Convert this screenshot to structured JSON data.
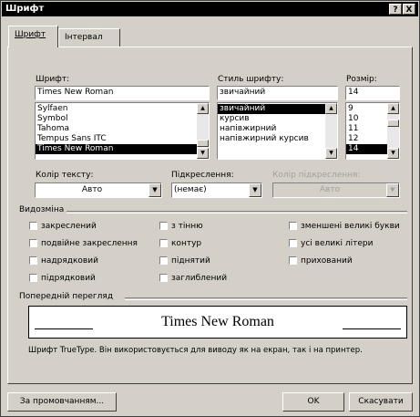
{
  "window": {
    "title": "Шрифт",
    "help_label": "?",
    "close_label": "X"
  },
  "tabs": [
    {
      "label": "Шрифт"
    },
    {
      "label": "Інтервал"
    }
  ],
  "font": {
    "label": "Шрифт:",
    "value": "Times New Roman",
    "items": [
      "Sylfaen",
      "Symbol",
      "Tahoma",
      "Tempus Sans ITC",
      "Times New Roman"
    ],
    "selected": "Times New Roman"
  },
  "style": {
    "label": "Стиль шрифту:",
    "value": "звичайний",
    "items": [
      "звичайний",
      "курсив",
      "напівжирний",
      "напівжирний курсив"
    ],
    "selected": "звичайний"
  },
  "size": {
    "label": "Розмір:",
    "value": "14",
    "items": [
      "9",
      "10",
      "11",
      "12",
      "14"
    ],
    "selected": "14"
  },
  "color": {
    "label": "Колір тексту:",
    "value": "Авто"
  },
  "underline": {
    "label": "Підкреслення:",
    "value": "(немає)"
  },
  "underline_color": {
    "label": "Колір підкреслення:",
    "value": "Авто"
  },
  "effects": {
    "title": "Видозміна",
    "items": [
      {
        "label": "закреслений"
      },
      {
        "label": "подвійне закреслення"
      },
      {
        "label": "надрядковий"
      },
      {
        "label": "підрядковий"
      },
      {
        "label": "з тінню"
      },
      {
        "label": "контур"
      },
      {
        "label": "піднятий"
      },
      {
        "label": "заглиблений"
      },
      {
        "label": "зменшені великі букви"
      },
      {
        "label": "усі великі літери"
      },
      {
        "label": "прихований"
      }
    ]
  },
  "preview": {
    "title": "Попередній перегляд",
    "sample": "Times New Roman",
    "note": "Шрифт TrueType. Він використовується для виводу як на екран, так і на принтер."
  },
  "buttons": {
    "default": "За промовчанням...",
    "ok": "OK",
    "cancel": "Скасувати"
  }
}
